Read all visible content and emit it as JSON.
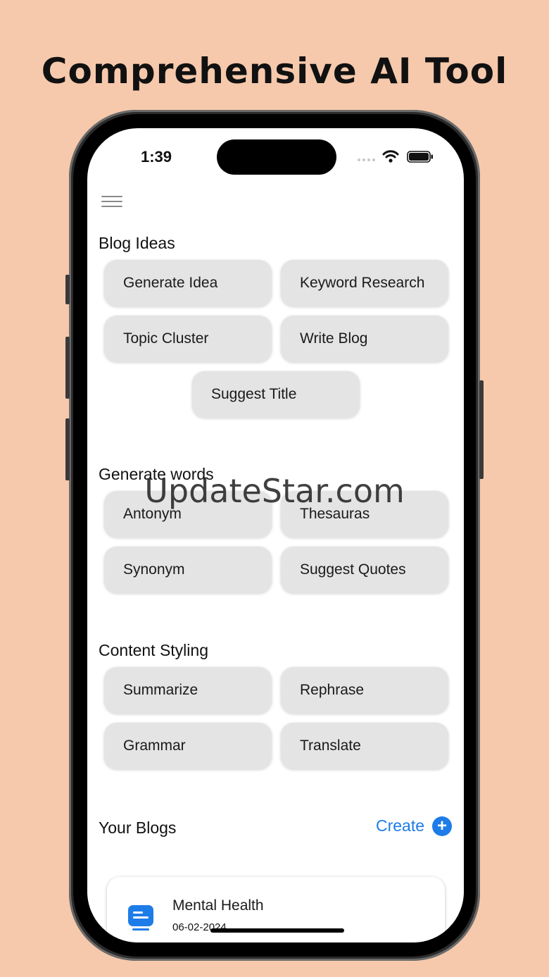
{
  "headline": "Comprehensive AI Tool",
  "status_bar": {
    "time": "1:39"
  },
  "icons": {
    "menu": "hamburger-menu-icon",
    "wifi": "wifi-icon",
    "battery": "battery-icon",
    "plus": "plus-circle-icon",
    "document": "document-icon"
  },
  "colors": {
    "background": "#f6c9ac",
    "accent": "#1e7ce8",
    "pill": "#e4e4e4"
  },
  "sections": {
    "blog_ideas": {
      "title": "Blog Ideas",
      "buttons": [
        "Generate Idea",
        "Keyword Research",
        "Topic Cluster",
        "Write Blog",
        "Suggest Title"
      ]
    },
    "generate_words": {
      "title": "Generate words",
      "buttons": [
        "Antonym",
        "Thesauras",
        "Synonym",
        "Suggest Quotes"
      ]
    },
    "content_styling": {
      "title": "Content Styling",
      "buttons": [
        "Summarize",
        "Rephrase",
        "Grammar",
        "Translate"
      ]
    }
  },
  "your_blogs": {
    "title": "Your Blogs",
    "create_label": "Create",
    "plus_glyph": "+",
    "items": [
      {
        "title": "Mental Health",
        "date": "06-02-2024"
      }
    ]
  },
  "watermark": "UpdateStar.com"
}
